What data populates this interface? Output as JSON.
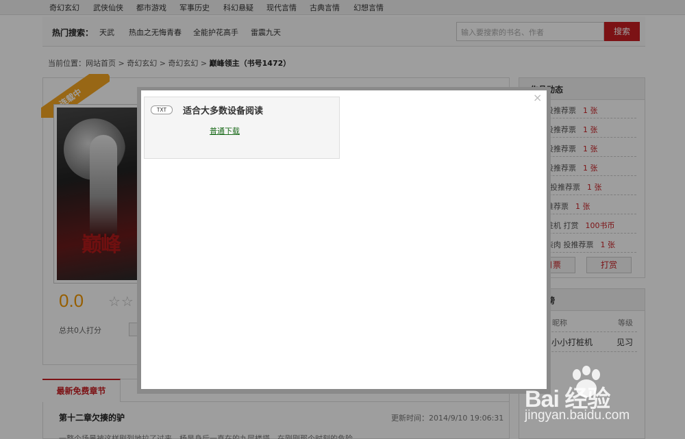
{
  "nav": {
    "items": [
      "奇幻玄幻",
      "武侠仙侠",
      "都市游戏",
      "军事历史",
      "科幻悬疑",
      "现代言情",
      "古典言情",
      "幻想言情"
    ]
  },
  "search": {
    "hot_label": "热门搜索：",
    "hot_items": [
      "天武",
      "热血之无悔青春",
      "全能护花高手",
      "雷震九天"
    ],
    "placeholder": "输入要搜索的书名、作者",
    "button": "搜索"
  },
  "breadcrumb": {
    "prefix": "当前位置：",
    "items": [
      "网站首页",
      "奇幻玄幻",
      "奇幻玄幻"
    ],
    "sep": " > ",
    "current": "巅峰领主（书号1472）"
  },
  "book": {
    "badge": "连载中",
    "cover_text": "巅峰",
    "score": "0.0",
    "stars": "☆☆",
    "rating_count": "总共0人打分"
  },
  "chapters": {
    "tab": "最新免费章节",
    "title": "第十二章欠揍的驴",
    "updated": "更新时间：2014/9/10 19:06:31",
    "excerpt": "一整个场景被这样剧烈地拉了过来，杨昊身后一直在的九层楼塔，在刚刚那个时刻的危险……"
  },
  "dynamics": {
    "title": "作品动态",
    "rows": [
      {
        "text": "投推荐票",
        "value": "1 张"
      },
      {
        "text": "投推荐票",
        "value": "1 张"
      },
      {
        "text": "投推荐票",
        "value": "1 张"
      },
      {
        "text": "投推荐票",
        "value": "1 张"
      },
      {
        "text": "投推荐票",
        "value": "1 张"
      },
      {
        "text": "推荐票",
        "value": "1 张"
      },
      {
        "text": "桩机 打赏",
        "value": "100书币"
      },
      {
        "text": "柴肉 投推荐票",
        "value": "1 张"
      }
    ],
    "btn_ticket": "月票",
    "btn_reward": "打赏"
  },
  "ranking": {
    "title": "排行榜",
    "col_name": "昵称",
    "col_level": "等级",
    "rows": [
      {
        "name": "小小打桩机",
        "level": "见习"
      }
    ]
  },
  "modal": {
    "badge": "TXT",
    "title": "适合大多数设备阅读",
    "link": "普通下载",
    "close": "×"
  },
  "watermark": {
    "text": "Bai 经验",
    "url": "jingyan.baidu.com"
  },
  "colors": {
    "accent_red": "#c81e22",
    "badge_orange": "#f5a623",
    "score_orange": "#f39800",
    "link_green": "#1a6a1a"
  }
}
